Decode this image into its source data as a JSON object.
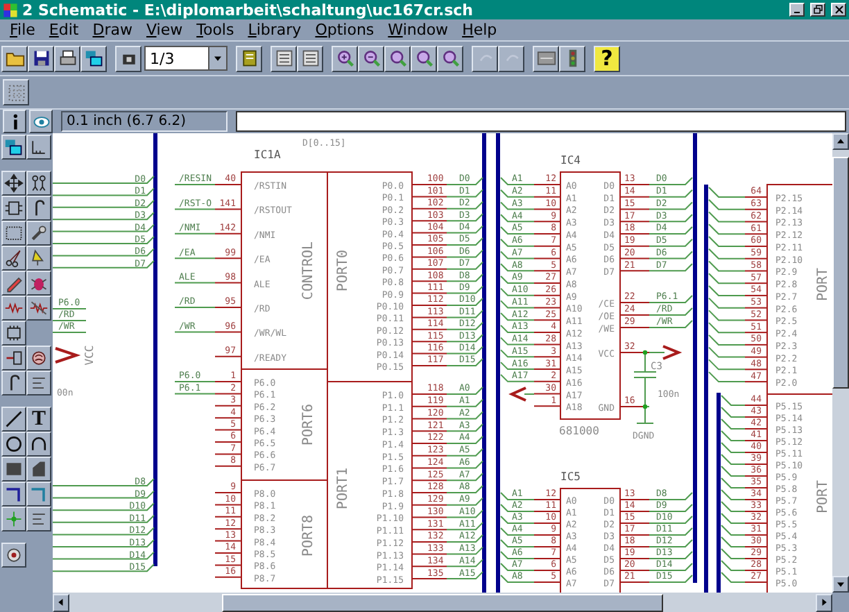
{
  "window": {
    "title": "2 Schematic - E:\\diplomarbeit\\schaltung\\uc167cr.sch"
  },
  "menu": [
    {
      "label": "File"
    },
    {
      "label": "Edit"
    },
    {
      "label": "Draw"
    },
    {
      "label": "View"
    },
    {
      "label": "Tools"
    },
    {
      "label": "Library"
    },
    {
      "label": "Options"
    },
    {
      "label": "Window"
    },
    {
      "label": "Help"
    }
  ],
  "toolbar": {
    "page": "1/3",
    "help": "?"
  },
  "status": {
    "grid": "0.1 inch (6.7 6.2)"
  },
  "palette": {
    "text_tool": "T"
  },
  "schematic": {
    "bus_label": "D[0..15]",
    "left_nets_upper": [
      "D0",
      "D1",
      "D2",
      "D3",
      "D4",
      "D5",
      "D6",
      "D7"
    ],
    "left_nets_lower": [
      "D8",
      "D9",
      "D10",
      "D11",
      "D12",
      "D13",
      "D14",
      "D15"
    ],
    "left_labels": [
      "P6.0",
      "/RD",
      "/WR"
    ],
    "left_power": "VCC",
    "left_value": "00n",
    "ic1a": {
      "ref": "IC1A",
      "blocks": [
        {
          "label": "CONTROL",
          "kind": "left",
          "pins": [
            {
              "net": "/RESIN",
              "pin": "40",
              "name": "/RSTIN"
            },
            {
              "net": "/RST-O",
              "pin": "141",
              "name": "/RSTOUT"
            },
            {
              "net": "/NMI",
              "pin": "142",
              "name": "/NMI"
            },
            {
              "net": "/EA",
              "pin": "99",
              "name": "/EA"
            },
            {
              "net": "ALE",
              "pin": "98",
              "name": "ALE"
            },
            {
              "net": "/RD",
              "pin": "95",
              "name": "/RD"
            },
            {
              "net": "/WR",
              "pin": "96",
              "name": "/WR/WL"
            },
            {
              "pin": "97",
              "name": "/READY"
            }
          ]
        },
        {
          "label": "PORT0",
          "kind": "right",
          "pins": [
            {
              "name": "P0.0",
              "pin": "100",
              "net": "D0"
            },
            {
              "name": "P0.1",
              "pin": "101",
              "net": "D1"
            },
            {
              "name": "P0.2",
              "pin": "102",
              "net": "D2"
            },
            {
              "name": "P0.3",
              "pin": "103",
              "net": "D3"
            },
            {
              "name": "P0.4",
              "pin": "104",
              "net": "D4"
            },
            {
              "name": "P0.5",
              "pin": "105",
              "net": "D5"
            },
            {
              "name": "P0.6",
              "pin": "106",
              "net": "D6"
            },
            {
              "name": "P0.7",
              "pin": "107",
              "net": "D7"
            },
            {
              "name": "P0.8",
              "pin": "108",
              "net": "D8"
            },
            {
              "name": "P0.9",
              "pin": "111",
              "net": "D9"
            },
            {
              "name": "P0.10",
              "pin": "112",
              "net": "D10"
            },
            {
              "name": "P0.11",
              "pin": "113",
              "net": "D11"
            },
            {
              "name": "P0.12",
              "pin": "114",
              "net": "D12"
            },
            {
              "name": "P0.13",
              "pin": "115",
              "net": "D13"
            },
            {
              "name": "P0.14",
              "pin": "116",
              "net": "D14"
            },
            {
              "name": "P0.15",
              "pin": "117",
              "net": "D15"
            }
          ]
        },
        {
          "label": "PORT6",
          "kind": "left",
          "pins": [
            {
              "net": "P6.0",
              "pin": "1",
              "name": "P6.0"
            },
            {
              "net": "P6.1",
              "pin": "2",
              "name": "P6.1"
            },
            {
              "pin": "3",
              "name": "P6.2"
            },
            {
              "pin": "4",
              "name": "P6.3"
            },
            {
              "pin": "5",
              "name": "P6.4"
            },
            {
              "pin": "6",
              "name": "P6.5"
            },
            {
              "pin": "7",
              "name": "P6.6"
            },
            {
              "pin": "8",
              "name": "P6.7"
            }
          ]
        },
        {
          "label": "PORT8",
          "kind": "left",
          "pins": [
            {
              "pin": "9",
              "name": "P8.0"
            },
            {
              "pin": "10",
              "name": "P8.1"
            },
            {
              "pin": "11",
              "name": "P8.2"
            },
            {
              "pin": "12",
              "name": "P8.3"
            },
            {
              "pin": "13",
              "name": "P8.4"
            },
            {
              "pin": "14",
              "name": "P8.5"
            },
            {
              "pin": "15",
              "name": "P8.6"
            },
            {
              "pin": "16",
              "name": "P8.7"
            }
          ]
        },
        {
          "label": "PORT1",
          "kind": "right",
          "pins": [
            {
              "name": "P1.0",
              "pin": "118",
              "net": "A0"
            },
            {
              "name": "P1.1",
              "pin": "119",
              "net": "A1"
            },
            {
              "name": "P1.2",
              "pin": "120",
              "net": "A2"
            },
            {
              "name": "P1.3",
              "pin": "121",
              "net": "A3"
            },
            {
              "name": "P1.4",
              "pin": "122",
              "net": "A4"
            },
            {
              "name": "P1.5",
              "pin": "123",
              "net": "A5"
            },
            {
              "name": "P1.6",
              "pin": "124",
              "net": "A6"
            },
            {
              "name": "P1.7",
              "pin": "125",
              "net": "A7"
            },
            {
              "name": "P1.8",
              "pin": "128",
              "net": "A8"
            },
            {
              "name": "P1.9",
              "pin": "129",
              "net": "A9"
            },
            {
              "name": "P1.10",
              "pin": "130",
              "net": "A10"
            },
            {
              "name": "P1.11",
              "pin": "131",
              "net": "A11"
            },
            {
              "name": "P1.12",
              "pin": "132",
              "net": "A12"
            },
            {
              "name": "P1.13",
              "pin": "133",
              "net": "A13"
            },
            {
              "name": "P1.14",
              "pin": "134",
              "net": "A14"
            },
            {
              "name": "P1.15",
              "pin": "135",
              "net": "A15"
            }
          ]
        }
      ]
    },
    "ic4": {
      "ref": "IC4",
      "part": "681000",
      "left": [
        {
          "net": "A1",
          "pin": "12",
          "name": "A0"
        },
        {
          "net": "A2",
          "pin": "11",
          "name": "A1"
        },
        {
          "net": "A3",
          "pin": "10",
          "name": "A2"
        },
        {
          "net": "A4",
          "pin": "9",
          "name": "A3"
        },
        {
          "net": "A5",
          "pin": "8",
          "name": "A4"
        },
        {
          "net": "A6",
          "pin": "7",
          "name": "A5"
        },
        {
          "net": "A7",
          "pin": "6",
          "name": "A6"
        },
        {
          "net": "A8",
          "pin": "5",
          "name": "A7"
        },
        {
          "net": "A9",
          "pin": "27",
          "name": "A8"
        },
        {
          "net": "A10",
          "pin": "26",
          "name": "A9"
        },
        {
          "net": "A11",
          "pin": "23",
          "name": "A10"
        },
        {
          "net": "A12",
          "pin": "25",
          "name": "A11"
        },
        {
          "net": "A13",
          "pin": "4",
          "name": "A12"
        },
        {
          "net": "A14",
          "pin": "28",
          "name": "A13"
        },
        {
          "net": "A15",
          "pin": "3",
          "name": "A14"
        },
        {
          "net": "A16",
          "pin": "31",
          "name": "A15"
        },
        {
          "net": "A17",
          "pin": "2",
          "name": "A16"
        },
        {
          "pin": "30",
          "name": "A17"
        },
        {
          "pin": "1",
          "name": "A18"
        }
      ],
      "right": [
        {
          "name": "D0",
          "pin": "13",
          "net": "D0"
        },
        {
          "name": "D1",
          "pin": "14",
          "net": "D1"
        },
        {
          "name": "D2",
          "pin": "15",
          "net": "D2"
        },
        {
          "name": "D3",
          "pin": "17",
          "net": "D3"
        },
        {
          "name": "D4",
          "pin": "18",
          "net": "D4"
        },
        {
          "name": "D5",
          "pin": "19",
          "net": "D5"
        },
        {
          "name": "D6",
          "pin": "20",
          "net": "D6"
        },
        {
          "name": "D7",
          "pin": "21",
          "net": "D7"
        },
        {
          "name": "/CE",
          "pin": "22",
          "net": "P6.1"
        },
        {
          "name": "/OE",
          "pin": "24",
          "net": "/RD"
        },
        {
          "name": "/WE",
          "pin": "29",
          "net": "/WR"
        },
        {
          "name": "VCC",
          "pin": "32"
        },
        {
          "name": "GND",
          "pin": "16"
        }
      ]
    },
    "capacitor": {
      "ref": "C3",
      "value": "100n",
      "ground": "DGND"
    },
    "ic5": {
      "ref": "IC5",
      "left": [
        {
          "net": "A1",
          "pin": "12",
          "name": "A0"
        },
        {
          "net": "A2",
          "pin": "11",
          "name": "A1"
        },
        {
          "net": "A3",
          "pin": "10",
          "name": "A2"
        },
        {
          "net": "A4",
          "pin": "9",
          "name": "A3"
        },
        {
          "net": "A5",
          "pin": "8",
          "name": "A4"
        },
        {
          "net": "A6",
          "pin": "7",
          "name": "A5"
        },
        {
          "net": "A7",
          "pin": "6",
          "name": "A6"
        },
        {
          "net": "A8",
          "pin": "5",
          "name": "A7"
        }
      ],
      "right": [
        {
          "name": "D0",
          "pin": "13",
          "net": "D8"
        },
        {
          "name": "D1",
          "pin": "14",
          "net": "D9"
        },
        {
          "name": "D2",
          "pin": "15",
          "net": "D10"
        },
        {
          "name": "D3",
          "pin": "17",
          "net": "D11"
        },
        {
          "name": "D4",
          "pin": "18",
          "net": "D12"
        },
        {
          "name": "D5",
          "pin": "19",
          "net": "D13"
        },
        {
          "name": "D6",
          "pin": "20",
          "net": "D14"
        },
        {
          "name": "D7",
          "pin": "21",
          "net": "D15"
        }
      ]
    },
    "right_ic": {
      "blocks": [
        {
          "label": "PORT",
          "pins": [
            {
              "pin": "64",
              "name": "P2.15"
            },
            {
              "pin": "63",
              "name": "P2.14"
            },
            {
              "pin": "62",
              "name": "P2.13"
            },
            {
              "pin": "61",
              "name": "P2.12"
            },
            {
              "pin": "60",
              "name": "P2.11"
            },
            {
              "pin": "59",
              "name": "P2.10"
            },
            {
              "pin": "58",
              "name": "P2.9"
            },
            {
              "pin": "57",
              "name": "P2.8"
            },
            {
              "pin": "54",
              "name": "P2.7"
            },
            {
              "pin": "53",
              "name": "P2.6"
            },
            {
              "pin": "52",
              "name": "P2.5"
            },
            {
              "pin": "51",
              "name": "P2.4"
            },
            {
              "pin": "50",
              "name": "P2.3"
            },
            {
              "pin": "49",
              "name": "P2.2"
            },
            {
              "pin": "48",
              "name": "P2.1"
            },
            {
              "pin": "47",
              "name": "P2.0"
            }
          ]
        },
        {
          "label": "PORT",
          "pins": [
            {
              "pin": "44",
              "name": "P5.15"
            },
            {
              "pin": "43",
              "name": "P5.14"
            },
            {
              "pin": "42",
              "name": "P5.13"
            },
            {
              "pin": "41",
              "name": "P5.12"
            },
            {
              "pin": "40",
              "name": "P5.11"
            },
            {
              "pin": "39",
              "name": "P5.10"
            },
            {
              "pin": "36",
              "name": "P5.9"
            },
            {
              "pin": "35",
              "name": "P5.8"
            },
            {
              "pin": "34",
              "name": "P5.7"
            },
            {
              "pin": "33",
              "name": "P5.6"
            },
            {
              "pin": "32",
              "name": "P5.5"
            },
            {
              "pin": "31",
              "name": "P5.4"
            },
            {
              "pin": "30",
              "name": "P5.3"
            },
            {
              "pin": "29",
              "name": "P5.2"
            },
            {
              "pin": "28",
              "name": "P5.1"
            },
            {
              "pin": "27",
              "name": "P5.0"
            }
          ]
        }
      ]
    }
  }
}
